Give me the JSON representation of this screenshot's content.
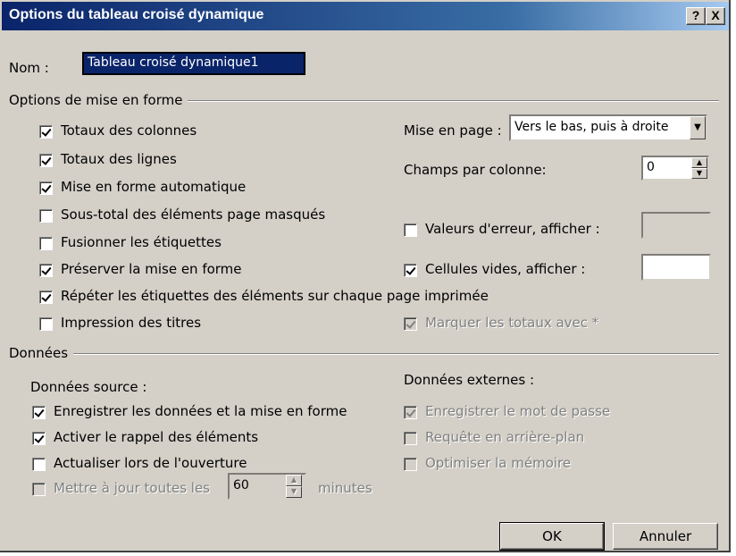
{
  "window": {
    "title": "Options du tableau croisé dynamique",
    "help_glyph": "?",
    "close_glyph": "X"
  },
  "name_field": {
    "label": "Nom :",
    "value": "Tableau croisé dynamique1"
  },
  "format_group": {
    "title": "Options de mise en forme",
    "totaux_colonnes": {
      "label": "Totaux des colonnes",
      "checked": true
    },
    "totaux_lignes": {
      "label": "Totaux des lignes",
      "checked": true
    },
    "mise_en_forme_auto": {
      "label": "Mise en forme automatique",
      "checked": true
    },
    "sous_total": {
      "label": "Sous-total des éléments page masqués",
      "checked": false
    },
    "fusionner": {
      "label": "Fusionner les étiquettes",
      "checked": false
    },
    "preserver": {
      "label": "Préserver la mise en forme",
      "checked": true
    },
    "repeter": {
      "label": "Répéter les étiquettes des éléments sur chaque page imprimée",
      "checked": true
    },
    "impression_titres": {
      "label": "Impression des titres",
      "checked": false
    },
    "mise_en_page": {
      "label": "Mise en page :",
      "value": "Vers le bas, puis à droite"
    },
    "champs_par_colonne": {
      "label": "Champs par colonne:",
      "value": "0"
    },
    "valeurs_erreur": {
      "label": "Valeurs d'erreur, afficher :",
      "checked": false,
      "value": ""
    },
    "cellules_vides": {
      "label": "Cellules vides, afficher :",
      "checked": true,
      "value": ""
    },
    "marquer_totaux": {
      "label": "Marquer les totaux avec *",
      "checked": true,
      "disabled": true
    }
  },
  "data_group": {
    "title": "Données",
    "source_title": "Données source :",
    "enregistrer_donnees": {
      "label": "Enregistrer les données et la mise en forme",
      "checked": true
    },
    "activer_rappel": {
      "label": "Activer le rappel des éléments",
      "checked": true
    },
    "actualiser": {
      "label": "Actualiser lors de l'ouverture",
      "checked": false
    },
    "mettre_a_jour": {
      "label": "Mettre à jour toutes les",
      "checked": false,
      "disabled": true,
      "value": "60",
      "unit": "minutes"
    },
    "external_title": "Données externes :",
    "enregistrer_mdp": {
      "label": "Enregistrer le mot de passe",
      "checked": true,
      "disabled": true
    },
    "requete_arriere_plan": {
      "label": "Requête en arrière-plan",
      "checked": false,
      "disabled": true
    },
    "optimiser_memoire": {
      "label": "Optimiser la mémoire",
      "checked": false,
      "disabled": true
    }
  },
  "buttons": {
    "ok": "OK",
    "cancel": "Annuler"
  },
  "colors": {
    "dialog_bg": "#d4d0c8",
    "title_bar": "#0a246a",
    "title_bar_end": "#a6caf0",
    "disabled_text": "#808080"
  }
}
